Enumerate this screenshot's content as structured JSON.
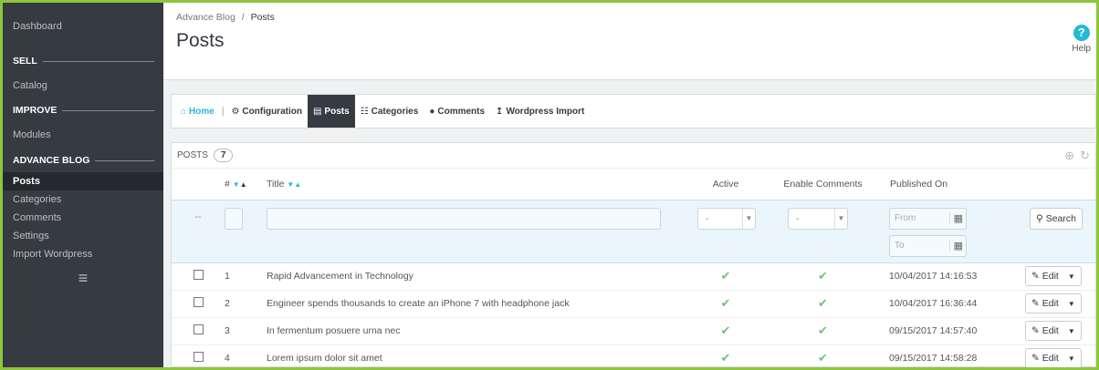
{
  "sidebar": {
    "dashboard": "Dashboard",
    "sell": "SELL",
    "catalog": "Catalog",
    "improve": "IMPROVE",
    "modules": "Modules",
    "advance_blog": "ADVANCE BLOG",
    "items": [
      "Posts",
      "Categories",
      "Comments",
      "Settings",
      "Import Wordpress"
    ]
  },
  "header": {
    "breadcrumb_parent": "Advance Blog",
    "breadcrumb_sep": "/",
    "breadcrumb_current": "Posts",
    "title": "Posts",
    "help_label": "Help"
  },
  "tabs": {
    "home": "Home",
    "configuration": "Configuration",
    "posts": "Posts",
    "categories": "Categories",
    "comments": "Comments",
    "wordpress_import": "Wordpress Import"
  },
  "panel": {
    "title": "POSTS",
    "count": "7",
    "columns": {
      "id": "#",
      "title": "Title",
      "active": "Active",
      "enable_comments": "Enable Comments",
      "published_on": "Published On"
    },
    "filters": {
      "dash": "--",
      "active_value": "-",
      "comments_value": "-",
      "from_placeholder": "From",
      "to_placeholder": "To",
      "search_label": "Search"
    },
    "edit_label": "Edit",
    "rows": [
      {
        "id": "1",
        "title": "Rapid Advancement in Technology",
        "date": "10/04/2017 14:16:53"
      },
      {
        "id": "2",
        "title": "Engineer spends thousands to create an iPhone 7 with headphone jack",
        "date": "10/04/2017 16:36:44"
      },
      {
        "id": "3",
        "title": "In fermentum posuere urna nec",
        "date": "09/15/2017 14:57:40"
      },
      {
        "id": "4",
        "title": "Lorem ipsum dolor sit amet",
        "date": "09/15/2017 14:58:28"
      }
    ]
  },
  "colors": {
    "frame": "#8cc63f",
    "sidebar": "#363a41",
    "accent": "#25b9d7",
    "check": "#72c279"
  }
}
